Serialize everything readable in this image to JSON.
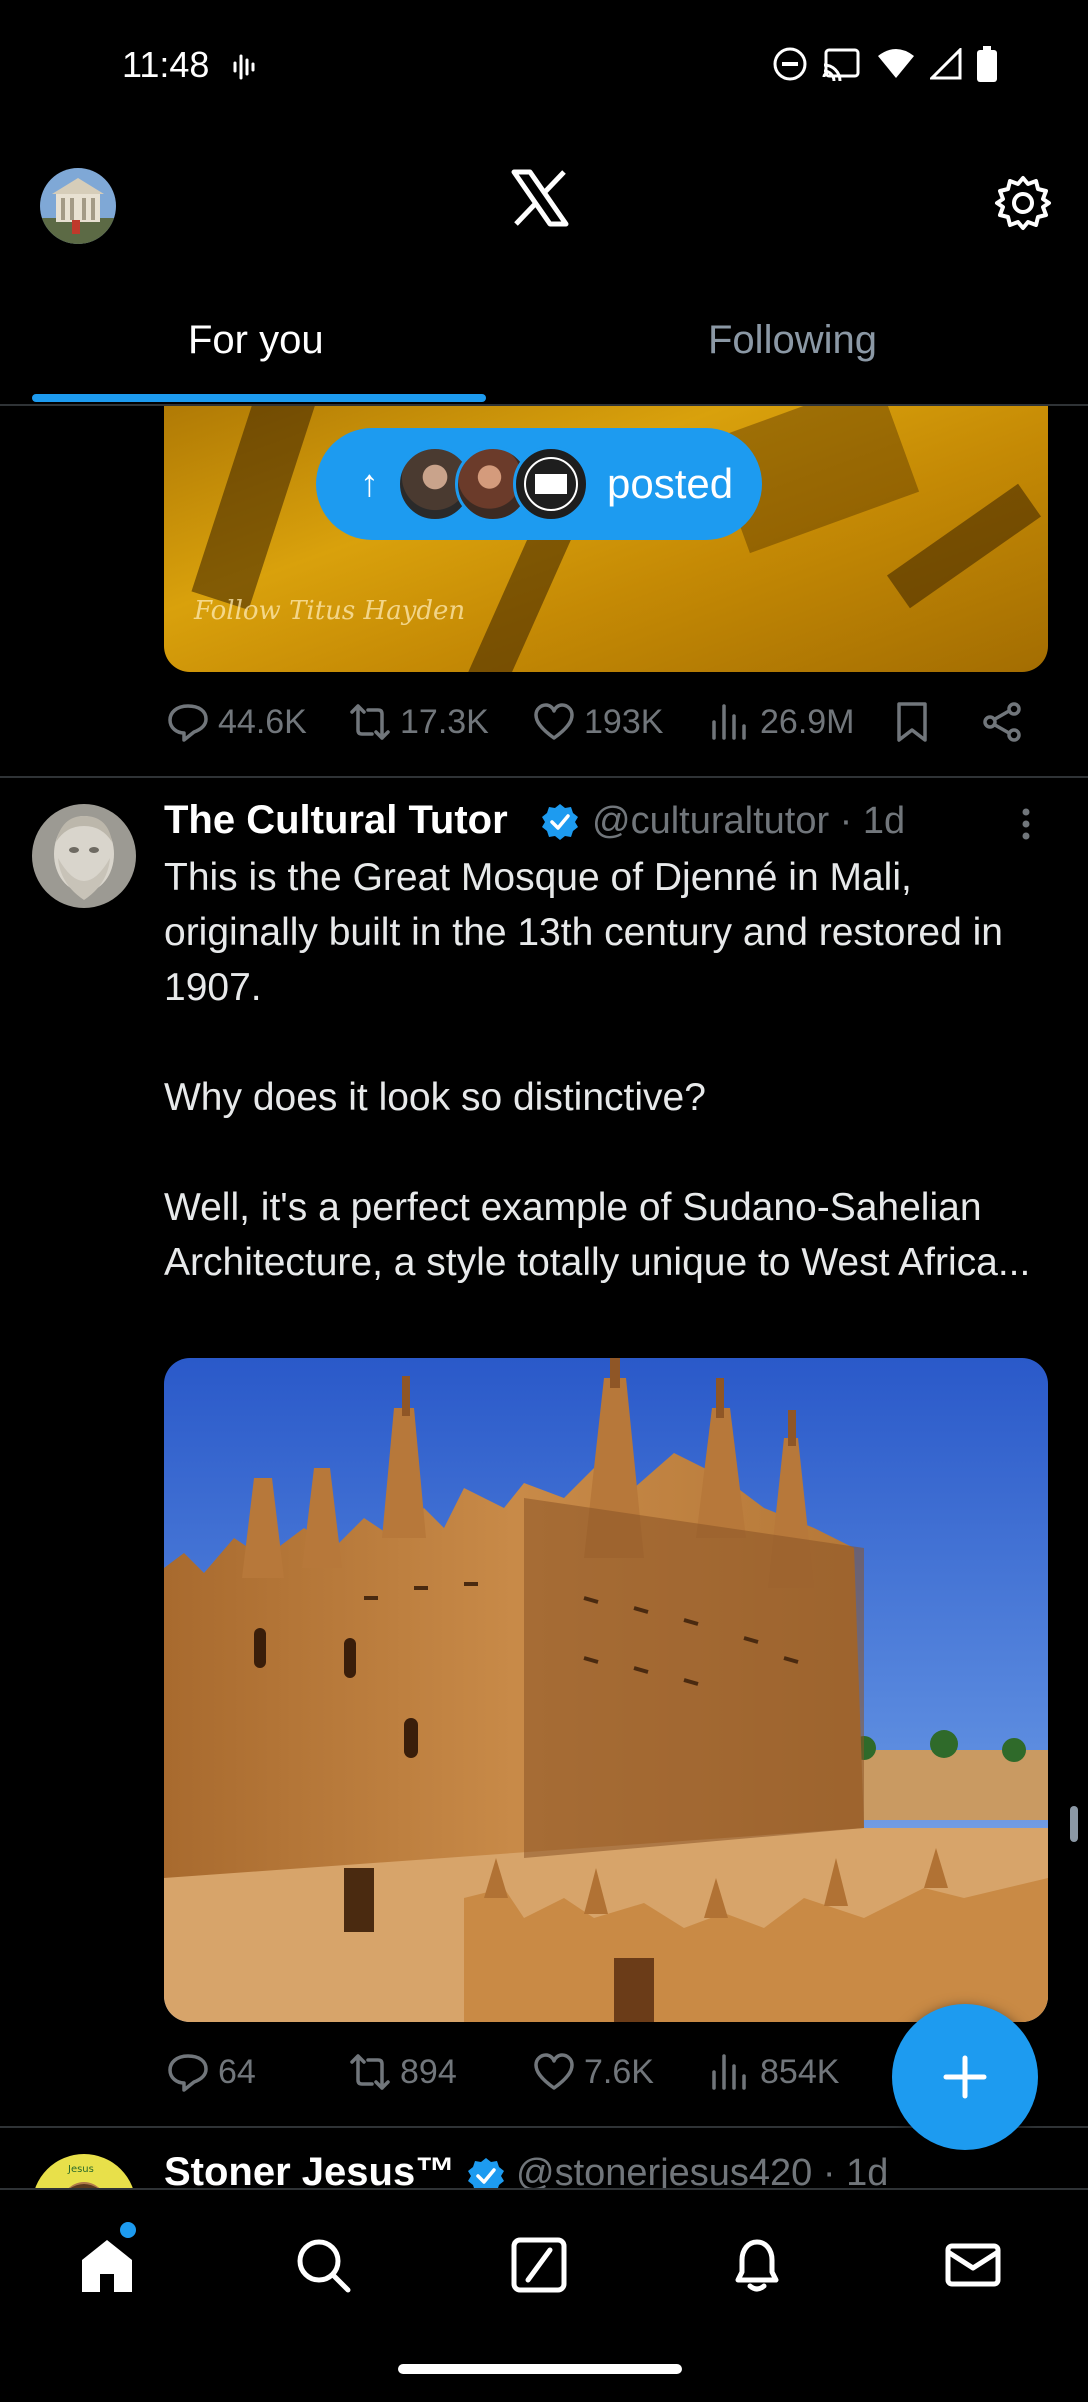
{
  "status_bar": {
    "time": "11:48",
    "icons": [
      "sound-wave-icon",
      "dnd-icon",
      "cast-icon",
      "wifi-icon",
      "signal-icon",
      "battery-icon"
    ]
  },
  "header": {
    "logo": "X",
    "icons": [
      "profile-avatar",
      "x-logo-icon",
      "settings-gear-icon"
    ]
  },
  "tabs": [
    {
      "label": "For you",
      "active": true
    },
    {
      "label": "Following",
      "active": false
    }
  ],
  "prev_post": {
    "media_watermark": "Follow Titus Hayden",
    "pill_label": "posted",
    "actions": {
      "replies": "44.6K",
      "reposts": "17.3K",
      "likes": "193K",
      "views": "26.9M"
    }
  },
  "tweet": {
    "author_name": "The Cultural Tutor",
    "handle_time": "@culturaltutor · 1d",
    "body": "This is the Great Mosque of Djenné in Mali, originally built in the 13th century and restored in 1907.\n\nWhy does it look so distinctive?\n\nWell, it's a perfect example of Sudano-Sahelian Architecture, a style totally unique to West Africa...",
    "actions": {
      "replies": "64",
      "reposts": "894",
      "likes": "7.6K",
      "views": "854K"
    }
  },
  "next_tweet": {
    "author_name": "Stoner Jesus™",
    "handle_time": "@stonerjesus420 · 1d"
  },
  "colors": {
    "accent": "#1d9bf0",
    "background": "#000000",
    "muted": "#71767b"
  }
}
